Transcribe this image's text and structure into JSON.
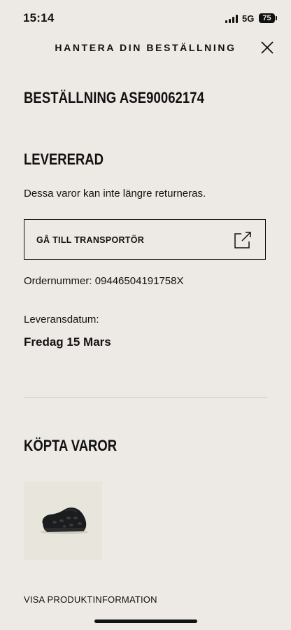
{
  "status_bar": {
    "time": "15:14",
    "network": "5G",
    "battery": "75"
  },
  "header": {
    "title": "HANTERA DIN BESTÄLLNING",
    "close_icon": "close-icon"
  },
  "order": {
    "heading": "BESTÄLLNING ASE90062174",
    "status": "LEVERERAD",
    "return_note": "Dessa varor kan inte längre returneras.",
    "carrier_button_label": "GÅ TILL TRANSPORTÖR",
    "carrier_button_icon": "external-link-icon",
    "order_number": "Ordernummer: 09446504191758X",
    "delivery_label": "Leveransdatum:",
    "delivery_date": "Fredag 15 Mars"
  },
  "purchased": {
    "heading": "KÖPTA VAROR",
    "product_image": "black-foam-shoe-image",
    "product_info_link": "VISA PRODUKTINFORMATION"
  },
  "colors": {
    "background": "#edeae5",
    "text": "#111111",
    "divider": "#cfcbc4",
    "thumb_background": "#e7e5dc"
  }
}
